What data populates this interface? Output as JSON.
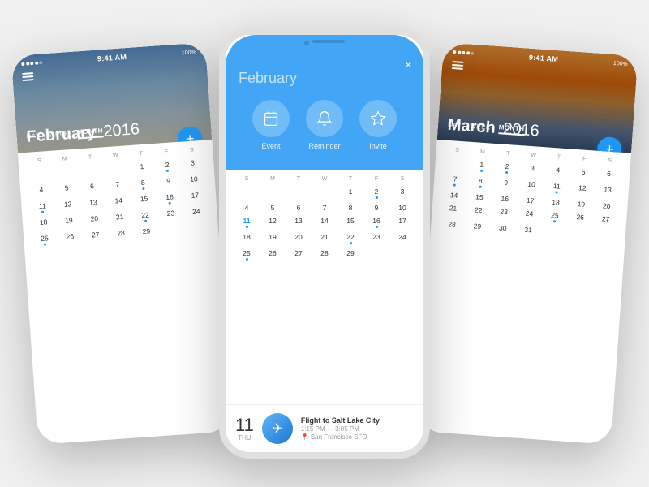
{
  "colors": {
    "blue": "#2196f3",
    "lightBlue": "#42a5f5",
    "white": "#ffffff",
    "textDark": "#333333",
    "textLight": "#999999"
  },
  "leftPhone": {
    "statusTime": "9:41 AM",
    "battery": "100%",
    "title": "February",
    "year": "2016",
    "tabs": [
      "DAY",
      "WEEK",
      "MONTH"
    ],
    "activeTab": "MONTH",
    "fab": "+",
    "dayHeaders": [
      "S",
      "M",
      "T",
      "W",
      "T",
      "F",
      "S"
    ],
    "weeks": [
      [
        "",
        "",
        "",
        "1",
        "2",
        "3",
        "4",
        "5",
        "6"
      ],
      [
        "7",
        "8",
        "9",
        "10",
        "11",
        "12",
        "13"
      ],
      [
        "14",
        "15",
        "16",
        "17",
        "18",
        "19",
        "20"
      ],
      [
        "21",
        "22",
        "23",
        "24",
        "25",
        "26",
        "27"
      ],
      [
        "28",
        "29",
        "",
        "",
        "",
        "",
        ""
      ]
    ],
    "todayDate": "1",
    "dotDates": [
      "2",
      "8",
      "11",
      "16",
      "22",
      "25"
    ]
  },
  "centerPhone": {
    "actionHeader": {
      "monthLabel": "February",
      "closeLabel": "×",
      "buttons": [
        {
          "icon": "📅",
          "label": "Event"
        },
        {
          "icon": "🔔",
          "label": "Reminder"
        },
        {
          "icon": "⭐",
          "label": "Invite"
        }
      ]
    },
    "dayHeaders": [
      "S",
      "M",
      "T",
      "W",
      "T",
      "F",
      "S"
    ],
    "weeks": [
      [
        "",
        "",
        "",
        "",
        "1",
        "2",
        "3",
        "4",
        "5",
        "6"
      ],
      [
        "7",
        "8",
        "9",
        "10",
        "11",
        "12",
        "13"
      ],
      [
        "14",
        "15",
        "16",
        "17",
        "18",
        "19",
        "20"
      ],
      [
        "21",
        "22",
        "23",
        "24",
        "25",
        "26",
        "27"
      ],
      [
        "28",
        "29",
        "",
        "",
        "",
        "",
        ""
      ]
    ],
    "highlightDate": "11",
    "dotDates": [
      "2",
      "11",
      "16",
      "22",
      "25"
    ],
    "event": {
      "dateNum": "11",
      "dateDay": "Thu",
      "title": "Flight to Salt Lake City",
      "time": "1:15 PM — 3:05 PM",
      "location": "San Francisco SFO"
    }
  },
  "rightPhone": {
    "statusTime": "9:41 AM",
    "battery": "100%",
    "title": "March",
    "year": "2016",
    "tabs": [
      "DAY",
      "WEEK",
      "MONTH"
    ],
    "activeTab": "MONTH",
    "fab": "+",
    "dayHeaders": [
      "S",
      "M",
      "T",
      "W",
      "T",
      "F",
      "S"
    ],
    "weeks": [
      [
        "",
        "1",
        "2",
        "3",
        "4",
        "5"
      ],
      [
        "6",
        "7",
        "8",
        "9",
        "10",
        "11",
        "12"
      ],
      [
        "13",
        "14",
        "15",
        "16",
        "17",
        "18",
        "19"
      ],
      [
        "20",
        "21",
        "22",
        "23",
        "24",
        "25",
        "26"
      ],
      [
        "27",
        "28",
        "29",
        "30",
        "31",
        "",
        ""
      ]
    ],
    "dotDates": [
      "2",
      "8",
      "11",
      "17",
      "25"
    ]
  }
}
